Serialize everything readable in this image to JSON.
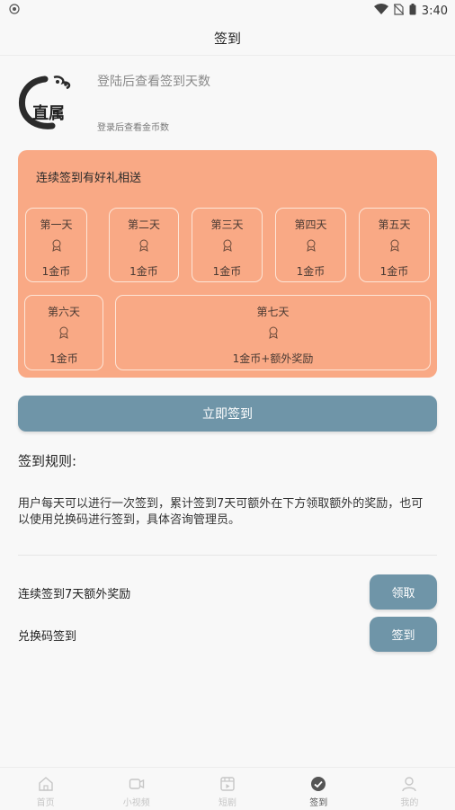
{
  "status_bar": {
    "time": "3:40",
    "icons": [
      "notification-icon",
      "wifi-icon",
      "no-sim-icon",
      "battery-icon"
    ]
  },
  "header": {
    "title": "签到"
  },
  "profile": {
    "avatar_text": "直属",
    "login_prompt": "登陆后查看签到天数",
    "coins_prompt": "登录后查看金币数"
  },
  "rewards": {
    "title": "连续签到有好礼相送",
    "days": [
      {
        "label": "第一天",
        "reward": "1金币"
      },
      {
        "label": "第二天",
        "reward": "1金币"
      },
      {
        "label": "第三天",
        "reward": "1金币"
      },
      {
        "label": "第四天",
        "reward": "1金币"
      },
      {
        "label": "第五天",
        "reward": "1金币"
      },
      {
        "label": "第六天",
        "reward": "1金币"
      },
      {
        "label": "第七天",
        "reward": "1金币+额外奖励"
      }
    ]
  },
  "sign_button": {
    "label": "立即签到"
  },
  "rules": {
    "heading": "签到规则:",
    "text": "用户每天可以进行一次签到，累计签到7天可额外在下方领取额外的奖励，也可以使用兑换码进行签到，具体咨询管理员。"
  },
  "actions": [
    {
      "label": "连续签到7天额外奖励",
      "button": "领取"
    },
    {
      "label": "兑换码签到",
      "button": "签到"
    }
  ],
  "nav": {
    "items": [
      {
        "label": "首页",
        "icon": "home-icon"
      },
      {
        "label": "小视频",
        "icon": "video-icon"
      },
      {
        "label": "短剧",
        "icon": "film-icon"
      },
      {
        "label": "签到",
        "icon": "check-circle-icon",
        "active": true
      },
      {
        "label": "我的",
        "icon": "user-icon"
      }
    ]
  },
  "colors": {
    "rewards_panel": "#f9a985",
    "primary_button": "#6f95a8",
    "card_border": "#fde5d7",
    "nav_inactive": "#c6c6c6"
  }
}
